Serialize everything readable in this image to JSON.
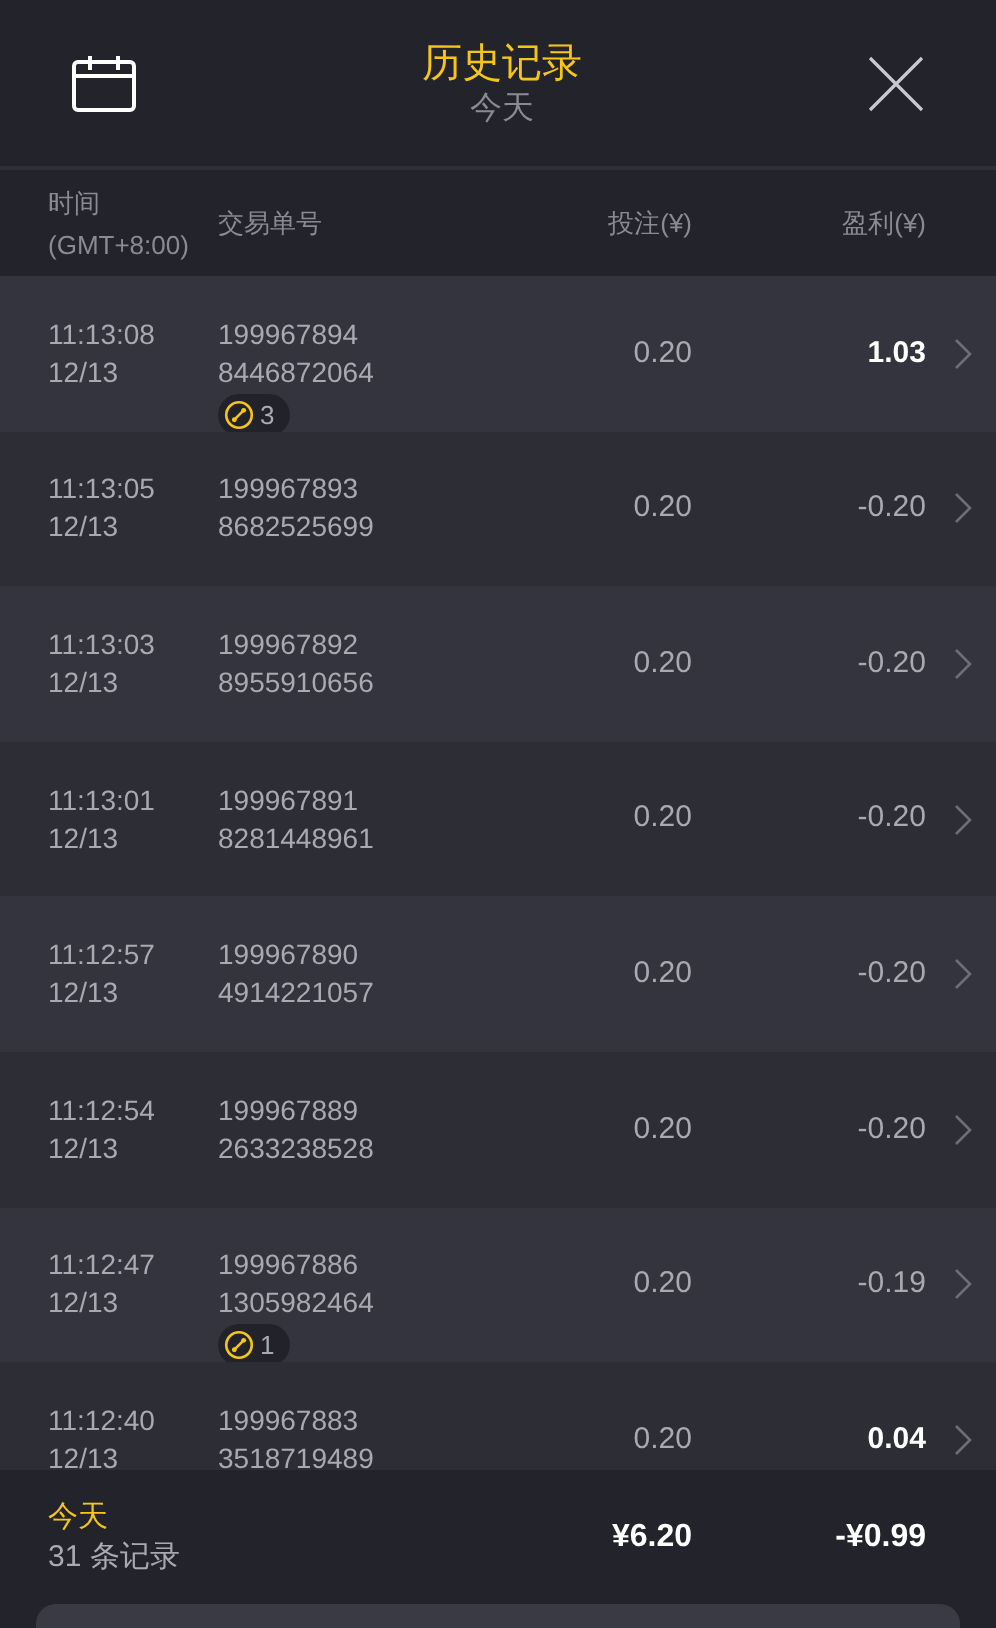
{
  "header": {
    "title": "历史记录",
    "subtitle": "今天"
  },
  "columns": {
    "time": "时间",
    "timezone": "(GMT+8:00)",
    "order": "交易单号",
    "bet": "投注(¥)",
    "profit": "盈利(¥)"
  },
  "rows": [
    {
      "time": "11:13:08",
      "date": "12/13",
      "order_1": "199967894",
      "order_2": "8446872064",
      "bonus": true,
      "bonus_count": "3",
      "bet": "0.20",
      "profit": "1.03",
      "win": true
    },
    {
      "time": "11:13:05",
      "date": "12/13",
      "order_1": "199967893",
      "order_2": "8682525699",
      "bonus": false,
      "bet": "0.20",
      "profit": "-0.20",
      "win": false
    },
    {
      "time": "11:13:03",
      "date": "12/13",
      "order_1": "199967892",
      "order_2": "8955910656",
      "bonus": false,
      "bet": "0.20",
      "profit": "-0.20",
      "win": false
    },
    {
      "time": "11:13:01",
      "date": "12/13",
      "order_1": "199967891",
      "order_2": "8281448961",
      "bonus": false,
      "bet": "0.20",
      "profit": "-0.20",
      "win": false
    },
    {
      "time": "11:12:57",
      "date": "12/13",
      "order_1": "199967890",
      "order_2": "4914221057",
      "bonus": false,
      "bet": "0.20",
      "profit": "-0.20",
      "win": false
    },
    {
      "time": "11:12:54",
      "date": "12/13",
      "order_1": "199967889",
      "order_2": "2633238528",
      "bonus": false,
      "bet": "0.20",
      "profit": "-0.20",
      "win": false
    },
    {
      "time": "11:12:47",
      "date": "12/13",
      "order_1": "199967886",
      "order_2": "1305982464",
      "bonus": true,
      "bonus_count": "1",
      "bet": "0.20",
      "profit": "-0.19",
      "win": false
    },
    {
      "time": "11:12:40",
      "date": "12/13",
      "order_1": "199967883",
      "order_2": "3518719489",
      "bonus": false,
      "bet": "0.20",
      "profit": "0.04",
      "win": true
    }
  ],
  "footer": {
    "period": "今天",
    "count": "31 条记录",
    "total_bet": "¥6.20",
    "total_profit": "-¥0.99"
  }
}
